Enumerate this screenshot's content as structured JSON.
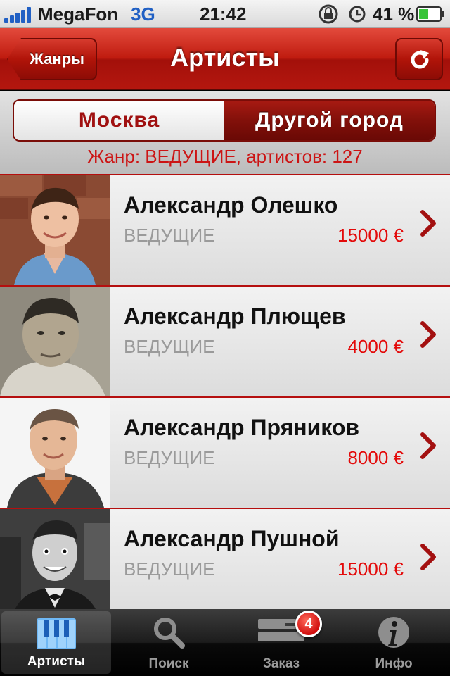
{
  "status_bar": {
    "carrier": "MegaFon",
    "network": "3G",
    "time": "21:42",
    "battery": "41 %",
    "icons": [
      "signal-bars-icon",
      "rotation-lock-icon",
      "alarm-clock-icon",
      "battery-icon"
    ]
  },
  "nav": {
    "back_label": "Жанры",
    "title": "Артисты",
    "refresh_icon": "refresh-icon"
  },
  "segmented": {
    "items": [
      "Москва",
      "Другой город"
    ],
    "selected": "Москва"
  },
  "genre_info": "Жанр: ВЕДУЩИЕ, артистов: 127",
  "artists": [
    {
      "name": "Александр Олешко",
      "genre": "ВЕДУЩИЕ",
      "price": "15000 €"
    },
    {
      "name": "Александр Плющев",
      "genre": "ВЕДУЩИЕ",
      "price": "4000 €"
    },
    {
      "name": "Александр Пряников",
      "genre": "ВЕДУЩИЕ",
      "price": "8000 €"
    },
    {
      "name": "Александр Пушной",
      "genre": "ВЕДУЩИЕ",
      "price": "15000 €"
    }
  ],
  "tabs": [
    {
      "label": "Артисты",
      "icon": "piano-keys-icon",
      "active": true
    },
    {
      "label": "Поиск",
      "icon": "magnifier-icon",
      "active": false
    },
    {
      "label": "Заказ",
      "icon": "order-stack-icon",
      "active": false,
      "badge": "4"
    },
    {
      "label": "Инфо",
      "icon": "info-icon",
      "active": false
    }
  ],
  "colors": {
    "nav_red": "#c01c10",
    "price_red": "#e30a0a",
    "genre_info_red": "#cc1414",
    "carrier_blue": "#2160c4"
  }
}
